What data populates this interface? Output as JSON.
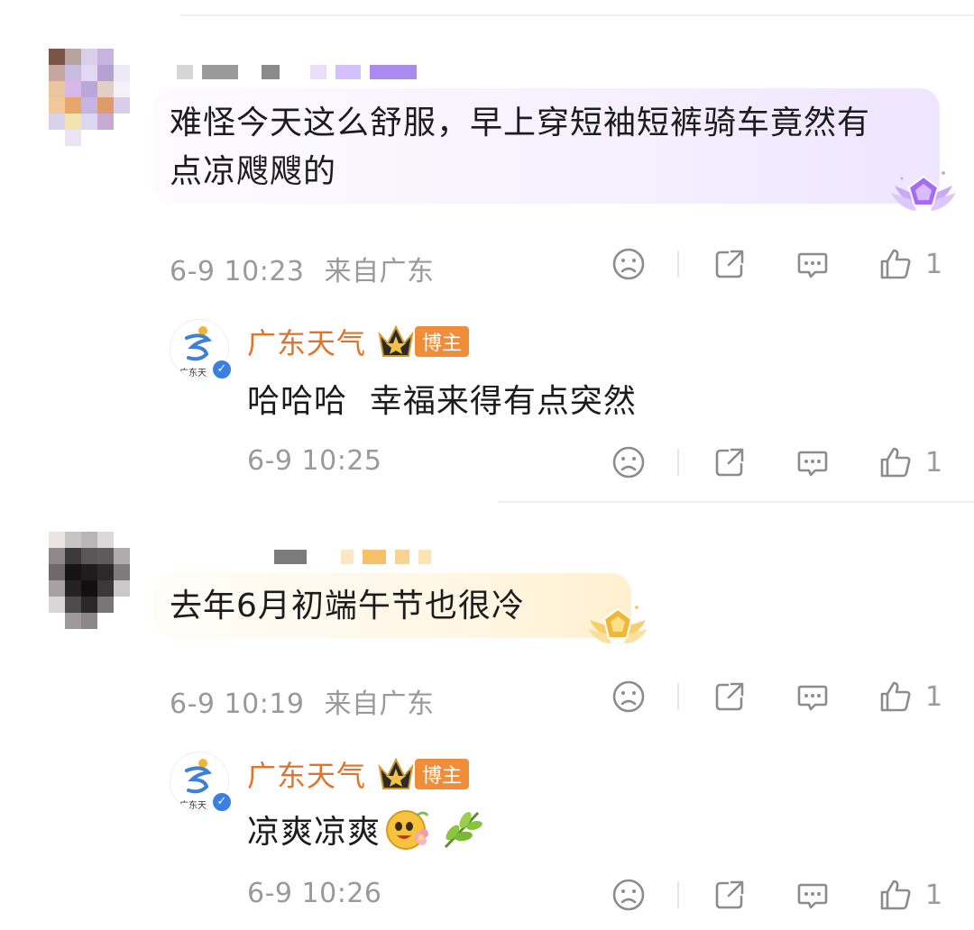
{
  "comments": [
    {
      "text": "难怪今天这么舒服，早上穿短袖短裤骑车竟然有点凉飕飕的",
      "text_line1": "难怪今天这么舒服，早上穿短袖短裤骑车竟然有",
      "text_line2": "点凉飕飕的",
      "time": "6-9 10:23",
      "location": "来自广东",
      "likes": "1",
      "badge_color": "#b07cf0",
      "reply": {
        "author": "广东天气",
        "badge": "博主",
        "avatar_caption": "广东天",
        "text": "哈哈哈  幸福来得有点突然",
        "time": "6-9 10:25",
        "likes": "1"
      }
    },
    {
      "text": "去年6月初端午节也很冷",
      "time": "6-9 10:19",
      "location": "来自广东",
      "likes": "1",
      "badge_color": "#f2b636",
      "reply": {
        "author": "广东天气",
        "badge": "博主",
        "avatar_caption": "广东天",
        "text": "凉爽凉爽",
        "emoji": [
          "smiling-face-with-flower-emoji",
          "leaf-emoji"
        ],
        "time": "6-9 10:26",
        "likes": "1"
      }
    }
  ],
  "icons": {
    "dislike": "sad-face-icon",
    "share": "share-icon",
    "comment": "comment-bubble-icon",
    "like": "thumbs-up-icon"
  },
  "colors": {
    "author": "#e0732e",
    "badge_bg": "#ef8d3b",
    "meta_text": "#9a9a9a"
  }
}
